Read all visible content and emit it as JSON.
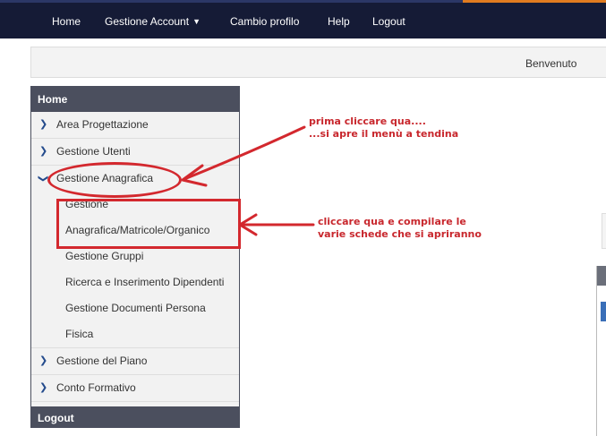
{
  "topbar": {
    "items": [
      {
        "label": "Home"
      },
      {
        "label": "Gestione Account"
      },
      {
        "label": "Cambio profilo"
      },
      {
        "label": "Help"
      },
      {
        "label": "Logout"
      }
    ],
    "caret_icon": "caret-down-icon"
  },
  "welcome": {
    "text": "Benvenuto"
  },
  "sidebar": {
    "header": "Home",
    "items": [
      {
        "label": "Area Progettazione",
        "icon": "chevron-right-icon"
      },
      {
        "label": "Gestione Utenti",
        "icon": "chevron-right-icon"
      },
      {
        "label": "Gestione Anagrafica",
        "icon": "chevron-down-icon"
      }
    ],
    "submenu": [
      {
        "label": "Gestione"
      },
      {
        "label": "Anagrafica/Matricole/Organico"
      },
      {
        "label": "Gestione Gruppi"
      },
      {
        "label": "Ricerca e Inserimento Dipendenti"
      },
      {
        "label": "Gestione Documenti Persona"
      },
      {
        "label": "Fisica"
      }
    ],
    "items_after": [
      {
        "label": "Gestione del Piano",
        "icon": "chevron-right-icon"
      },
      {
        "label": "Conto Formativo",
        "icon": "chevron-right-icon"
      }
    ],
    "footer": "Logout"
  },
  "annotations": {
    "first": [
      "prima cliccare qua....",
      "...si apre il menù a tendina"
    ],
    "second": [
      "cliccare qua e compilare le",
      "varie schede che si apriranno"
    ],
    "color": "#c8272d"
  },
  "colors": {
    "navbar": "#151b36",
    "sidebar_header": "#4b4f5e",
    "accent_orange": "#e07b20"
  }
}
